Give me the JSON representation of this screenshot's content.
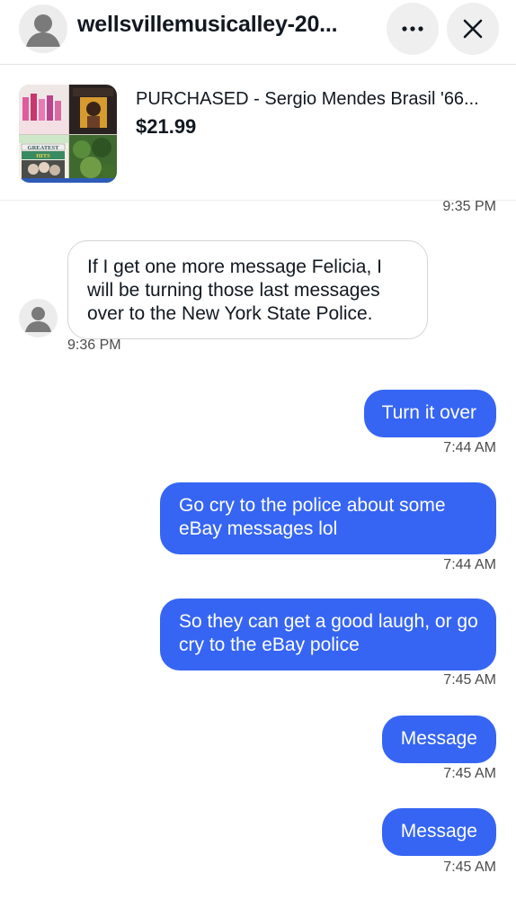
{
  "header": {
    "seller_name": "wellsvillemusicalley-20...",
    "more_icon": "more-horizontal-icon",
    "close_icon": "close-icon"
  },
  "item": {
    "title": "PURCHASED - Sergio Mendes Brasil '66...",
    "price": "$21.99",
    "thumb_texts": {
      "greatest": "GREATEST",
      "hits": "HITS"
    }
  },
  "conversation": {
    "top_time": "9:35 PM",
    "messages": [
      {
        "sender": "seller",
        "text": "If I get one more message Felicia, I will be turning those last messages over to the New York State Police.",
        "time": "9:36 PM"
      },
      {
        "sender": "me",
        "text": "Turn it over",
        "time": "7:44 AM"
      },
      {
        "sender": "me",
        "text": "Go cry to the police about some eBay messages lol",
        "time": "7:44 AM"
      },
      {
        "sender": "me",
        "text": "So they can get a good laugh, or go cry to the eBay police",
        "time": "7:45 AM"
      },
      {
        "sender": "me",
        "text": "Message",
        "time": "7:45 AM"
      },
      {
        "sender": "me",
        "text": "Message",
        "time": "7:45 AM"
      }
    ]
  },
  "colors": {
    "outgoing_bubble": "#3665f3",
    "outgoing_text": "#ffffff",
    "incoming_border": "#d4d4d4",
    "timestamp": "#4b4b4b"
  }
}
